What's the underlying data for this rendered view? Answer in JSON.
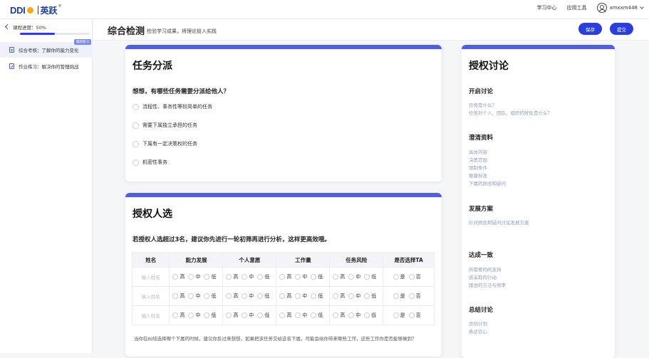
{
  "topbar": {
    "logo_ddi": "DDI",
    "logo_brand": "英跃",
    "logo_reg": "®",
    "nav_links": [
      "学习中心",
      "应用工具"
    ],
    "username": "xmxxm448"
  },
  "sidebar": {
    "progress_label": "课程进度：50%",
    "progress_value": 0.5,
    "items": [
      {
        "label": "综合考核：了解你的能力变化",
        "badge": "最新练习"
      },
      {
        "label": "作业练习：解决你的管理挑战"
      }
    ]
  },
  "header": {
    "title": "综合检测",
    "subtitle": "检验学习成果，将理论投入实践",
    "save_label": "保存",
    "submit_label": "提交"
  },
  "assign_card": {
    "title": "任务分派",
    "question": "想想，有哪些任务需要分派给他人？",
    "options": [
      "流程性、事务性等较简单的任务",
      "需要下属独立承担的任务",
      "下属有一定决策权的任务",
      "机密性事务"
    ]
  },
  "candidate_card": {
    "title": "授权人选",
    "question": "若授权人选超过3名，建议你先进行一轮初筛再进行分析，这样更高效哦。",
    "columns": [
      "姓名",
      "能力发展",
      "个人意愿",
      "工作量",
      "任务风险",
      "是否选择TA"
    ],
    "name_placeholder": "输入姓名",
    "level_options": [
      "高",
      "中",
      "低"
    ],
    "yes_no": [
      "是",
      "否"
    ],
    "note": "当你在纠结选择哪个下属的时候，建议你反过来想想，如果把该任务交给这名下属，可能会给你带来哪些工作，这些工作你是否能够做到？"
  },
  "discussion": {
    "title": "授权讨论",
    "sections": [
      {
        "heading": "开启讨论",
        "lines": [
          "任务是什么？",
          "任务对个人、团队、组织的好处是什么？"
        ]
      },
      {
        "heading": "澄清资料",
        "lines": [
          "具体内容",
          "决策范围",
          "限制条件",
          "衡量标准",
          "下属的顾虑和疑问"
        ]
      },
      {
        "heading": "发展方案",
        "lines": [
          "针对顾虑和疑问讨论发展方案"
        ]
      },
      {
        "heading": "达成一致",
        "lines": [
          "所需要的的支持",
          "该采取的行动",
          "跟进的方法与频率"
        ]
      },
      {
        "heading": "总结讨论",
        "lines": [
          "总结计划",
          "表达信心"
        ]
      }
    ]
  },
  "colors": {
    "accent": "#2b3fd6",
    "card_bar": "#4f5fe0",
    "muted_link": "#8fa0b8"
  }
}
